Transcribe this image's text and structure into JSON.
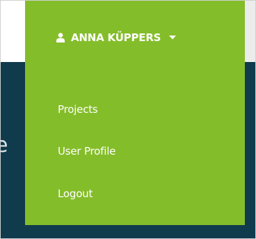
{
  "colors": {
    "dropdown_bg": "#84bd2a",
    "page_dark_bg": "#0f3b4c",
    "text": "#ffffff"
  },
  "user_menu": {
    "user_name": "ANNA KÜPPERS",
    "user_icon": "user-icon",
    "caret_icon": "caret-down-icon",
    "items": [
      {
        "label": "Projects"
      },
      {
        "label": "User Profile"
      },
      {
        "label": "Logout"
      }
    ]
  },
  "background": {
    "partial_glyph": "e"
  }
}
